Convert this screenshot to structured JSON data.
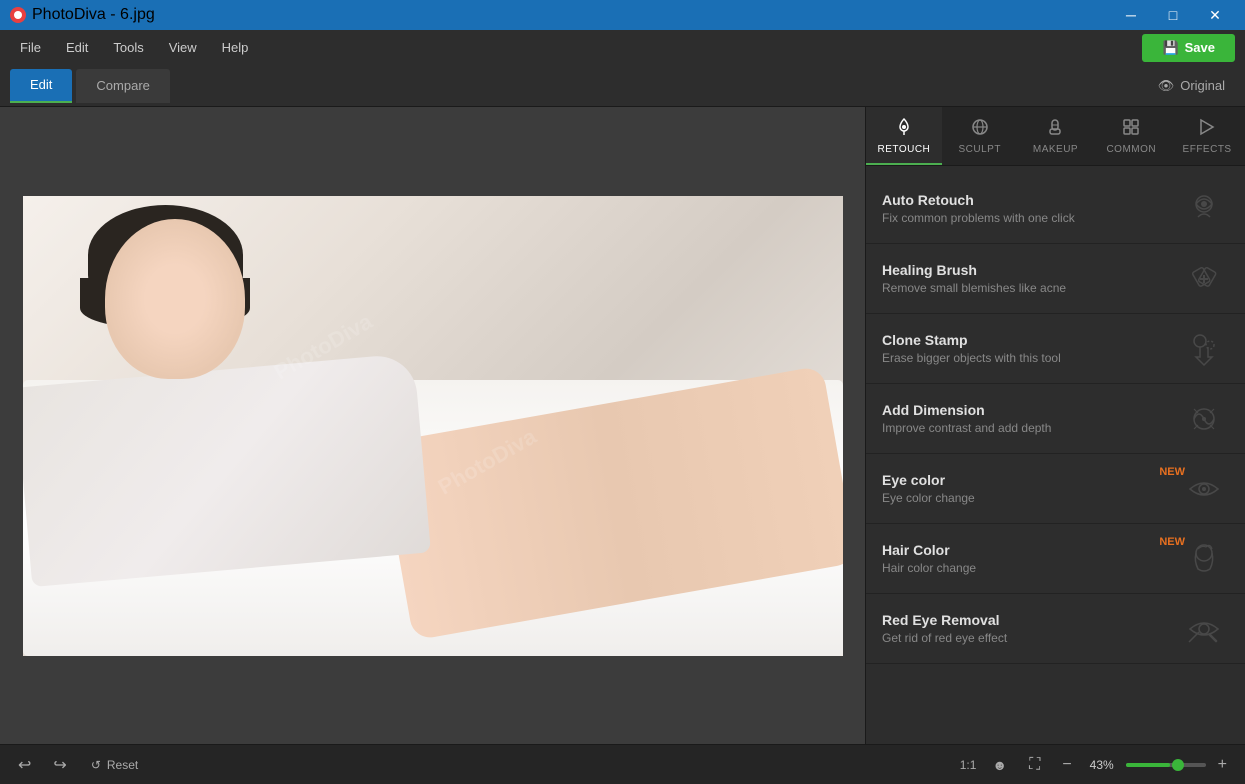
{
  "app": {
    "title": "PhotoDiva - 6.jpg",
    "logo_color": "#e84040"
  },
  "titlebar": {
    "title": "PhotoDiva - 6.jpg",
    "minimize": "─",
    "maximize": "□",
    "close": "✕"
  },
  "menubar": {
    "items": [
      "File",
      "Edit",
      "Tools",
      "View",
      "Help"
    ],
    "save_label": "Save"
  },
  "toolbar": {
    "edit_label": "Edit",
    "compare_label": "Compare",
    "original_label": "Original"
  },
  "panel_tabs": [
    {
      "id": "retouch",
      "label": "RETOUCH",
      "icon": "✦",
      "active": true
    },
    {
      "id": "sculpt",
      "label": "SCULPT",
      "icon": "◉"
    },
    {
      "id": "makeup",
      "label": "MAKEUP",
      "icon": "⊡"
    },
    {
      "id": "common",
      "label": "COMMON",
      "icon": "⊞"
    },
    {
      "id": "effects",
      "label": "EFFECTS",
      "icon": "▷"
    }
  ],
  "tools": [
    {
      "id": "auto-retouch",
      "name": "Auto Retouch",
      "desc": "Fix common problems with one click",
      "new": false,
      "icon": "✦"
    },
    {
      "id": "healing-brush",
      "name": "Healing Brush",
      "desc": "Remove small blemishes like acne",
      "new": false,
      "icon": "✚"
    },
    {
      "id": "clone-stamp",
      "name": "Clone Stamp",
      "desc": "Erase bigger objects with this tool",
      "new": false,
      "icon": "⊕"
    },
    {
      "id": "add-dimension",
      "name": "Add Dimension",
      "desc": "Improve contrast and add depth",
      "new": false,
      "icon": "◈"
    },
    {
      "id": "eye-color",
      "name": "Eye color",
      "desc": "Eye color change",
      "new": true,
      "new_label": "NEW",
      "icon": "◉"
    },
    {
      "id": "hair-color",
      "name": "Hair Color",
      "desc": "Hair color change",
      "new": true,
      "new_label": "NEW",
      "icon": "♟"
    },
    {
      "id": "red-eye",
      "name": "Red Eye Removal",
      "desc": "Get rid of red eye effect",
      "new": false,
      "icon": "◎"
    }
  ],
  "bottom": {
    "zoom_ratio": "1:1",
    "zoom_percent": "43%",
    "reset_label": "Reset"
  },
  "colors": {
    "active_tab": "#4caf50",
    "save_bg": "#3ab53a",
    "new_badge": "#e87020",
    "panel_bg": "#2d2d2d",
    "titlebar_bg": "#1a6fb5"
  }
}
